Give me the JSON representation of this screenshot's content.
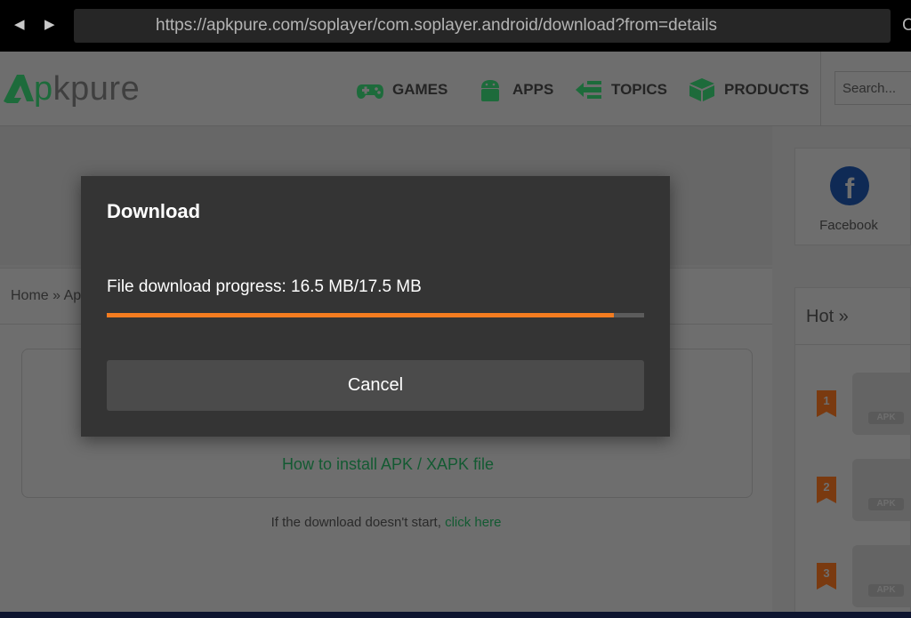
{
  "browser": {
    "back_glyph": "◀",
    "forward_glyph": "▶",
    "url": "https://apkpure.com/soplayer/com.soplayer.android/download?from=details",
    "edge_char": "C"
  },
  "site": {
    "logo": {
      "text_prefix": "p",
      "text_rest": "kpure"
    },
    "nav": [
      {
        "label": "GAMES",
        "icon": "gamepad-icon"
      },
      {
        "label": "APPS",
        "icon": "android-icon"
      },
      {
        "label": "TOPICS",
        "icon": "topics-icon"
      },
      {
        "label": "PRODUCTS",
        "icon": "box-icon"
      }
    ],
    "search": {
      "placeholder": "Search..."
    },
    "social": {
      "label": "Facebook",
      "icon": "facebook-icon"
    },
    "breadcrumb": "Home » Ap",
    "install_link": "How to install APK / XAPK file",
    "download_note": "If the download doesn't start, ",
    "download_note_link": "click here",
    "hot": {
      "title": "Hot »",
      "items": [
        {
          "rank": "1",
          "badge": "APK"
        },
        {
          "rank": "2",
          "badge": "APK"
        },
        {
          "rank": "3",
          "badge": "APK"
        }
      ]
    }
  },
  "dialog": {
    "title": "Download",
    "progress_text": "File download progress: 16.5 MB/17.5 MB",
    "progress_fraction": 0.943,
    "cancel_label": "Cancel",
    "accent_color": "#f47c20"
  }
}
